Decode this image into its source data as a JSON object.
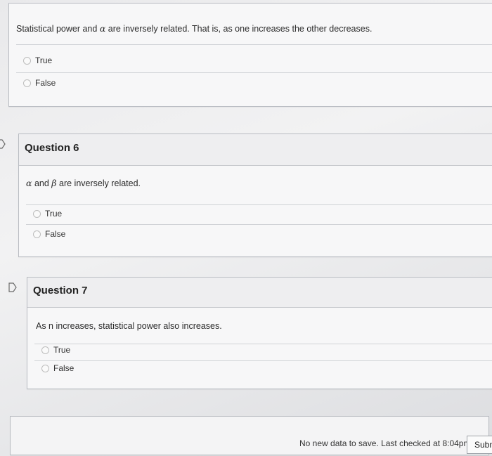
{
  "q5": {
    "prompt_before": "Statistical power and",
    "alpha": "α",
    "prompt_after": "are inversely related. That is, as one increases the other decreases.",
    "options": [
      "True",
      "False"
    ]
  },
  "q6": {
    "title": "Question 6",
    "alpha": "α",
    "and": "and",
    "beta": "β",
    "prompt_after": "are inversely related.",
    "options": [
      "True",
      "False"
    ]
  },
  "q7": {
    "title": "Question 7",
    "prompt": "As n increases, statistical power also increases.",
    "options": [
      "True",
      "False"
    ]
  },
  "footer": {
    "status": "No new data to save. Last checked at 8:04pm",
    "submit_label": "Subm"
  }
}
